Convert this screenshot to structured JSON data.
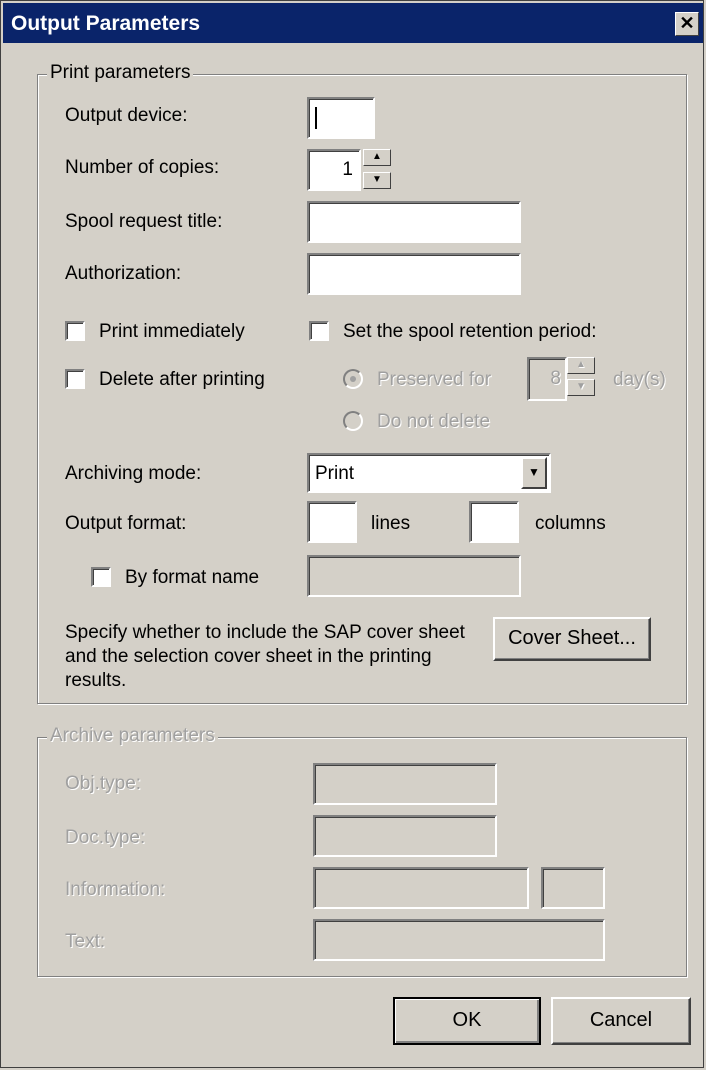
{
  "window": {
    "title": "Output Parameters",
    "close_glyph": "✕"
  },
  "print_params": {
    "legend": "Print parameters",
    "output_device": {
      "label": "Output device:",
      "value": ""
    },
    "copies": {
      "label": "Number of copies:",
      "value": "1"
    },
    "spool_title": {
      "label": "Spool request title:",
      "value": ""
    },
    "authorization": {
      "label": "Authorization:",
      "value": ""
    },
    "print_immediately": {
      "label": "Print immediately",
      "checked": false
    },
    "delete_after": {
      "label": "Delete after printing",
      "checked": false
    },
    "set_retention": {
      "label": "Set the spool retention period:",
      "checked": false
    },
    "preserved_for": {
      "label": "Preserved for",
      "selected": true
    },
    "days": {
      "value": "8",
      "unit": "day(s)"
    },
    "do_not_delete": {
      "label": "Do not delete",
      "selected": false
    },
    "archiving_mode": {
      "label": "Archiving mode:",
      "value": "Print"
    },
    "output_format": {
      "label": "Output format:",
      "lines_label": "lines",
      "columns_label": "columns",
      "lines_value": "",
      "columns_value": ""
    },
    "by_format_name": {
      "label": "By format name",
      "checked": false,
      "value": ""
    },
    "cover_text": "Specify whether to include the SAP cover sheet and the selection cover sheet in the printing results.",
    "cover_button": "Cover Sheet..."
  },
  "archive_params": {
    "legend": "Archive parameters",
    "obj_type": "Obj.type:",
    "doc_type": "Doc.type:",
    "information": "Information:",
    "text": "Text:"
  },
  "buttons": {
    "ok": "OK",
    "cancel": "Cancel"
  }
}
